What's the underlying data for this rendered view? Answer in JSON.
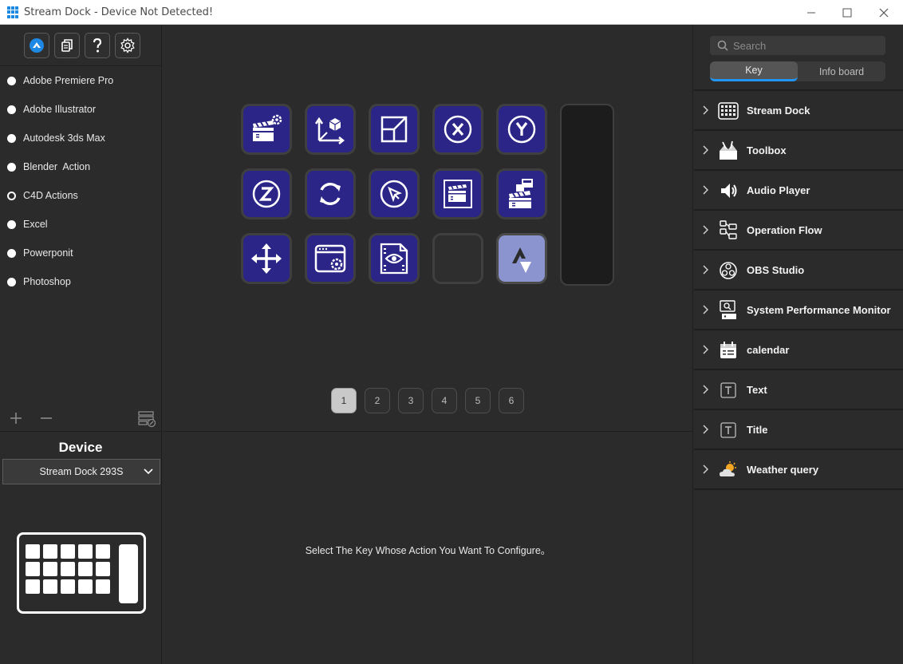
{
  "window": {
    "title": "Stream Dock - Device Not Detected!"
  },
  "toolbar": {
    "icons": [
      "app-logo-icon",
      "copy-icon",
      "help-icon",
      "gear-icon"
    ]
  },
  "apps": [
    {
      "label": "Adobe Premiere Pro"
    },
    {
      "label": "Adobe Illustrator"
    },
    {
      "label": "Autodesk 3ds Max"
    },
    {
      "label": "Blender  Action"
    },
    {
      "label": "C4D Actions"
    },
    {
      "label": "Excel"
    },
    {
      "label": "Powerponit"
    },
    {
      "label": "Photoshop"
    }
  ],
  "device": {
    "label": "Device",
    "selected": "Stream Dock 293S"
  },
  "keys": [
    {
      "icon": "clapper-gear-icon"
    },
    {
      "icon": "axis-cube-icon"
    },
    {
      "icon": "viewport-icon"
    },
    {
      "icon": "x-axis-icon"
    },
    {
      "icon": "y-axis-icon"
    },
    {
      "icon": "z-axis-icon"
    },
    {
      "icon": "rotate-icon"
    },
    {
      "icon": "cursor-icon"
    },
    {
      "icon": "render-frame-icon"
    },
    {
      "icon": "render-clapper-icon"
    },
    {
      "icon": "move-icon"
    },
    {
      "icon": "window-settings-icon"
    },
    {
      "icon": "preview-eye-icon"
    },
    {
      "icon": "empty"
    },
    {
      "icon": "logo-arrows-icon"
    }
  ],
  "pages": [
    "1",
    "2",
    "3",
    "4",
    "5",
    "6"
  ],
  "active_page": "1",
  "hint": "Select The Key Whose Action You Want To Configure。",
  "right": {
    "search_placeholder": "Search",
    "tabs": [
      {
        "label": "Key",
        "active": true
      },
      {
        "label": "Info board",
        "active": false
      }
    ],
    "plugins": [
      {
        "label": "Stream Dock",
        "icon": "grid-keypad-icon"
      },
      {
        "label": "Toolbox",
        "icon": "toolbox-icon"
      },
      {
        "label": "Audio Player",
        "icon": "speaker-icon"
      },
      {
        "label": "Operation Flow",
        "icon": "flow-icon"
      },
      {
        "label": "OBS Studio",
        "icon": "obs-icon"
      },
      {
        "label": "System Performance Monitor",
        "icon": "monitor-icon"
      },
      {
        "label": "calendar",
        "icon": "calendar-icon"
      },
      {
        "label": "Text",
        "icon": "text-icon"
      },
      {
        "label": "Title",
        "icon": "title-icon"
      },
      {
        "label": "Weather query",
        "icon": "weather-icon"
      }
    ]
  },
  "colors": {
    "accent": "#2196f3",
    "key_bg": "#2a2586",
    "key_light": "#8b94cf",
    "panel_bg": "#2b2b2b"
  }
}
